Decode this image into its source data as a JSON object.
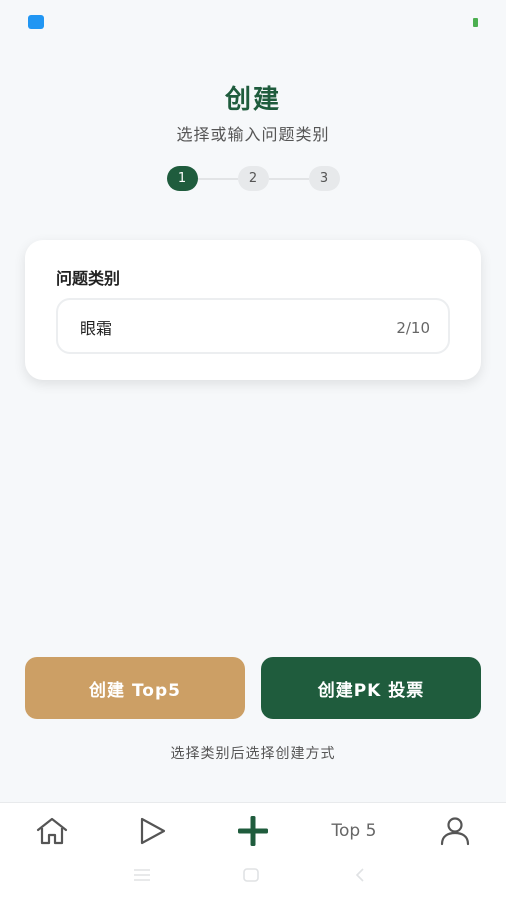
{
  "header": {
    "title": "创建",
    "subtitle": "选择或输入问题类别"
  },
  "stepper": {
    "steps": [
      {
        "label": "1",
        "active": true
      },
      {
        "label": "2",
        "active": false
      },
      {
        "label": "3",
        "active": false
      }
    ]
  },
  "category_card": {
    "label": "问题类别",
    "input_value": "眼霜",
    "char_count": "2/10"
  },
  "actions": {
    "create_top5_label": "创建 Top5",
    "create_pk_label": "创建PK 投票"
  },
  "hint": "选择类别后选择创建方式",
  "bottom_nav": {
    "items": [
      {
        "name": "home",
        "icon": "home-icon"
      },
      {
        "name": "play",
        "icon": "play-icon"
      },
      {
        "name": "create",
        "icon": "plus-icon"
      },
      {
        "name": "top5",
        "label": "Top 5"
      },
      {
        "name": "me",
        "icon": "user-icon"
      }
    ]
  },
  "colors": {
    "brand_green": "#1f5c3d",
    "gold": "#cc9f65",
    "background": "#f6f8fa"
  }
}
